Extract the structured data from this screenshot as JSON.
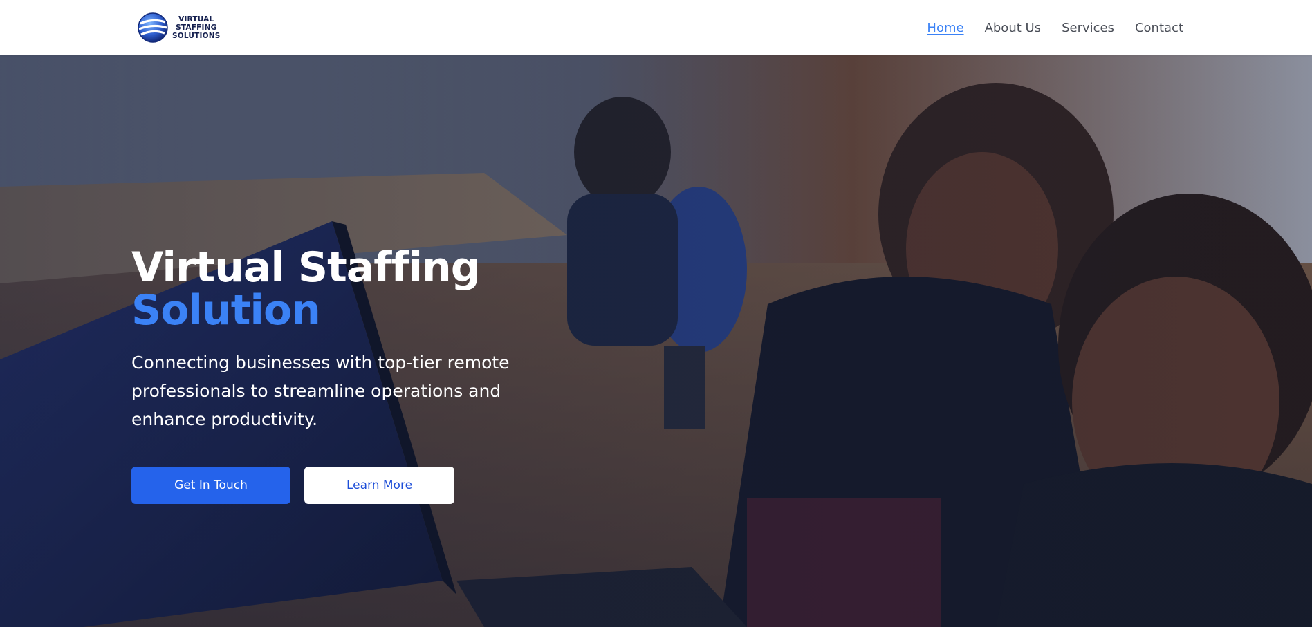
{
  "header": {
    "logo": {
      "line1": "VIRTUAL",
      "line2": "STAFFING",
      "line3": "SOLUTIONS"
    },
    "nav": [
      {
        "label": "Home",
        "active": true
      },
      {
        "label": "About Us",
        "active": false
      },
      {
        "label": "Services",
        "active": false
      },
      {
        "label": "Contact",
        "active": false
      }
    ]
  },
  "hero": {
    "title_line1": "Virtual Staffing",
    "title_line2": "Solution",
    "subtitle": "Connecting businesses with top-tier remote professionals to streamline operations and enhance productivity.",
    "primary_button": "Get In Touch",
    "secondary_button": "Learn More",
    "background_image": "office-team-working-on-laptop-photo"
  },
  "colors": {
    "accent": "#3b82f6",
    "primary_button": "#2563eb",
    "nav_text": "#4b4f58",
    "logo_text": "#15204f"
  }
}
